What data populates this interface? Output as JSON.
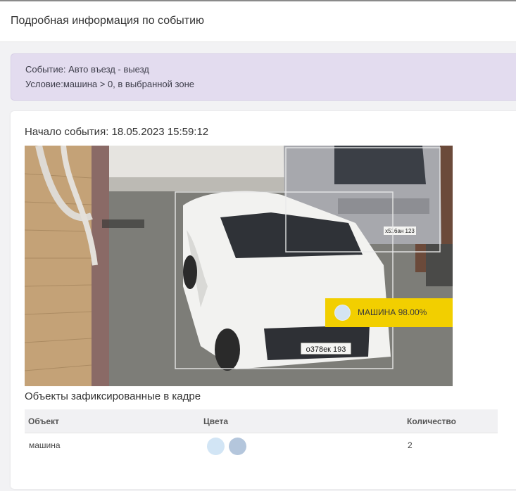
{
  "modal": {
    "title": "Подробная информация по событию"
  },
  "event": {
    "line1": "Событие: Авто въезд - выезд",
    "line2": "Условие:машина > 0, в выбранной зоне"
  },
  "card": {
    "start_label": "Начало события: 18.05.2023 15:59:12",
    "detection": {
      "label": "МАШИНА 98.00%",
      "color": "#d4e4f2"
    },
    "plates": {
      "front": "о378ек 193",
      "rear": "х516ан 123"
    },
    "objects_title": "Объекты зафиксированные в кадре",
    "table": {
      "headers": [
        "Объект",
        "Цвета",
        "Количество"
      ],
      "rows": [
        {
          "object": "машина",
          "colors": [
            "#d2e5f5",
            "#b4c6dc"
          ],
          "count": "2"
        }
      ]
    }
  }
}
